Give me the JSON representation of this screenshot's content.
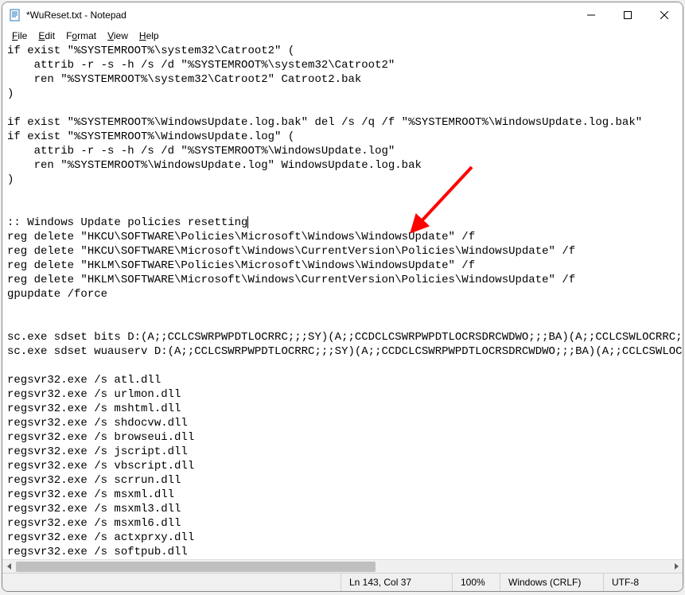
{
  "window": {
    "title": "*WuReset.txt - Notepad"
  },
  "menu": {
    "file": "File",
    "edit": "Edit",
    "format": "Format",
    "view": "View",
    "help": "Help"
  },
  "content": {
    "lines": [
      "if exist \"%SYSTEMROOT%\\system32\\Catroot2\" (",
      "    attrib -r -s -h /s /d \"%SYSTEMROOT%\\system32\\Catroot2\"",
      "    ren \"%SYSTEMROOT%\\system32\\Catroot2\" Catroot2.bak",
      ")",
      "",
      "if exist \"%SYSTEMROOT%\\WindowsUpdate.log.bak\" del /s /q /f \"%SYSTEMROOT%\\WindowsUpdate.log.bak\"",
      "if exist \"%SYSTEMROOT%\\WindowsUpdate.log\" (",
      "    attrib -r -s -h /s /d \"%SYSTEMROOT%\\WindowsUpdate.log\"",
      "    ren \"%SYSTEMROOT%\\WindowsUpdate.log\" WindowsUpdate.log.bak",
      ")",
      "",
      "",
      ":: Windows Update policies resetting",
      "reg delete \"HKCU\\SOFTWARE\\Policies\\Microsoft\\Windows\\WindowsUpdate\" /f",
      "reg delete \"HKCU\\SOFTWARE\\Microsoft\\Windows\\CurrentVersion\\Policies\\WindowsUpdate\" /f",
      "reg delete \"HKLM\\SOFTWARE\\Policies\\Microsoft\\Windows\\WindowsUpdate\" /f",
      "reg delete \"HKLM\\SOFTWARE\\Microsoft\\Windows\\CurrentVersion\\Policies\\WindowsUpdate\" /f",
      "gpupdate /force",
      "",
      "",
      "sc.exe sdset bits D:(A;;CCLCSWRPWPDTLOCRRC;;;SY)(A;;CCDCLCSWRPWPDTLOCRSDRCWDWO;;;BA)(A;;CCLCSWLOCRRC;;;AU",
      "sc.exe sdset wuauserv D:(A;;CCLCSWRPWPDTLOCRRC;;;SY)(A;;CCDCLCSWRPWPDTLOCRSDRCWDWO;;;BA)(A;;CCLCSWLOCRRC",
      "",
      "regsvr32.exe /s atl.dll",
      "regsvr32.exe /s urlmon.dll",
      "regsvr32.exe /s mshtml.dll",
      "regsvr32.exe /s shdocvw.dll",
      "regsvr32.exe /s browseui.dll",
      "regsvr32.exe /s jscript.dll",
      "regsvr32.exe /s vbscript.dll",
      "regsvr32.exe /s scrrun.dll",
      "regsvr32.exe /s msxml.dll",
      "regsvr32.exe /s msxml3.dll",
      "regsvr32.exe /s msxml6.dll",
      "regsvr32.exe /s actxprxy.dll",
      "regsvr32.exe /s softpub.dll"
    ],
    "cursor_line_index": 12
  },
  "status": {
    "position": "Ln 143, Col 37",
    "zoom": "100%",
    "line_ending": "Windows (CRLF)",
    "encoding": "UTF-8"
  },
  "annotation": {
    "arrow_color": "#ff0000"
  }
}
